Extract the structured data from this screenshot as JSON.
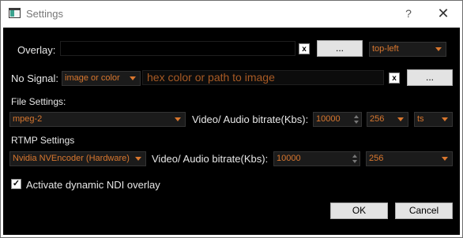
{
  "window": {
    "title": "Settings",
    "help_label": "?",
    "close_label": "✕"
  },
  "overlay": {
    "label": "Overlay:",
    "clear_label": "x",
    "browse_label": "...",
    "position_value": "top-left"
  },
  "no_signal": {
    "label": "No Signal:",
    "mode_value": "image or color",
    "placeholder": "hex color or path to image",
    "clear_label": "x",
    "browse_label": "..."
  },
  "file_settings": {
    "heading": "File Settings:",
    "codec_value": "mpeg-2",
    "bitrate_label": "Video/ Audio bitrate(Kbs):",
    "video_bitrate": "10000",
    "audio_bitrate": "256",
    "container_value": "ts"
  },
  "rtmp_settings": {
    "heading": "RTMP Settings",
    "encoder_value": "Nvidia NVEncoder (Hardware)",
    "bitrate_label": "Video/ Audio bitrate(Kbs):",
    "video_bitrate": "10000",
    "audio_bitrate": "256"
  },
  "ndi": {
    "checked": true,
    "check_mark": "✓",
    "label": "Activate dynamic NDI overlay"
  },
  "footer": {
    "ok_label": "OK",
    "cancel_label": "Cancel"
  },
  "colors": {
    "accent": "#d9772e",
    "background": "#000000"
  }
}
